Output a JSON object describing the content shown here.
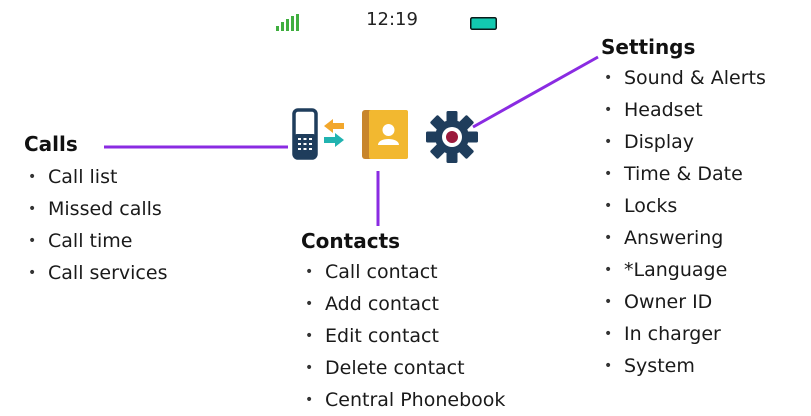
{
  "status_bar": {
    "time": "12:19"
  },
  "icons": {
    "signal": "signal-strength-icon",
    "battery": "battery-icon",
    "calls": "phone-icon",
    "transfer": "transfer-arrows-icon",
    "contacts": "contacts-book-icon",
    "settings": "gear-icon"
  },
  "colors": {
    "connector": "#8a2be2",
    "signal": "#3fae3f",
    "battery": "#12c9b0",
    "phone": "#1f3d5c",
    "contacts_book": "#f2b830",
    "gear": "#1f3d5c",
    "gear_center": "#9b1a3c"
  },
  "calls": {
    "title": "Calls",
    "items": [
      "Call list",
      "Missed calls",
      "Call time",
      "Call services"
    ]
  },
  "contacts": {
    "title": "Contacts",
    "items": [
      "Call contact",
      "Add contact",
      "Edit contact",
      "Delete contact",
      "Central Phonebook"
    ]
  },
  "settings": {
    "title": "Settings",
    "items": [
      "Sound & Alerts",
      "Headset",
      "Display",
      "Time & Date",
      "Locks",
      "Answering",
      "*Language",
      "Owner ID",
      "In charger",
      "System"
    ]
  }
}
